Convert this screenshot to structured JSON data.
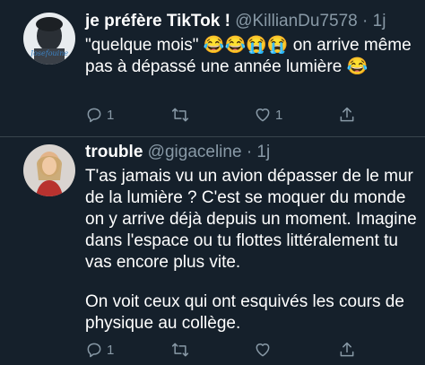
{
  "tweets": [
    {
      "display_name": "je préfère TikTok !",
      "handle": "@KillianDu7578",
      "time": "1j",
      "avatar_caption": "Josefouine",
      "text_lines": [
        "\"quelque mois\" 😂😂😭😭  on arrive même pas à dépassé une année lumière 😂"
      ],
      "actions": {
        "reply_count": "1",
        "retweet_count": "",
        "like_count": "1"
      }
    },
    {
      "display_name": "trouble",
      "handle": "@gigaceline",
      "time": "1j",
      "avatar_caption": "",
      "text_lines": [
        "T'as jamais vu un avion dépasser de le mur de la lumière ? C'est se moquer du monde on y arrive déjà depuis un moment. Imagine dans l'espace ou tu flottes littéralement tu vas encore plus vite.",
        "On voit ceux qui ont esquivés les cours de physique au collège."
      ],
      "actions": {
        "reply_count": "1",
        "retweet_count": "",
        "like_count": ""
      }
    }
  ],
  "colors": {
    "background": "#15202b",
    "secondary_text": "#8899a6",
    "divider": "#38444d"
  },
  "icons": [
    "reply-icon",
    "retweet-icon",
    "like-icon",
    "share-icon"
  ]
}
